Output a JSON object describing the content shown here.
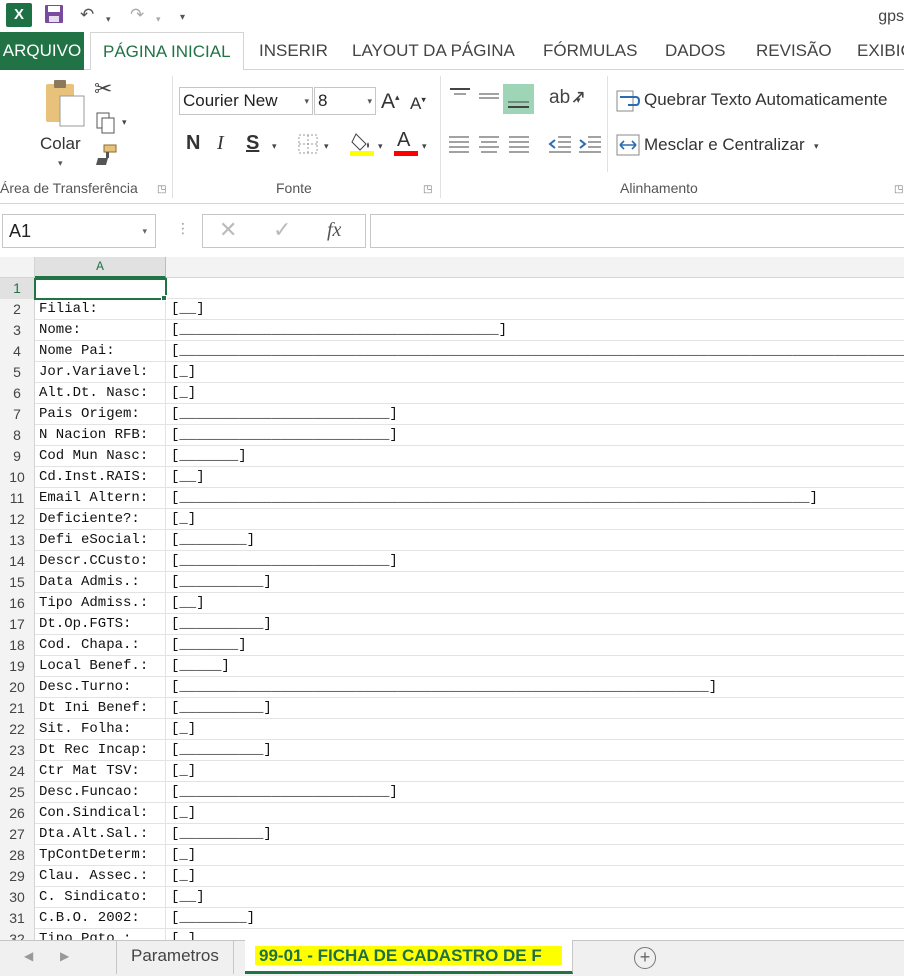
{
  "app": {
    "title": "gps"
  },
  "qat": {
    "logo_letter": "X",
    "save_icon": "save-icon",
    "undo_icon": "undo-icon",
    "redo_icon": "redo-icon",
    "customize_icon": "customize-qat-icon"
  },
  "tabs": [
    {
      "label": "ARQUIVO"
    },
    {
      "label": "PÁGINA INICIAL"
    },
    {
      "label": "INSERIR"
    },
    {
      "label": "LAYOUT DA PÁGINA"
    },
    {
      "label": "FÓRMULAS"
    },
    {
      "label": "DADOS"
    },
    {
      "label": "REVISÃO"
    },
    {
      "label": "EXIBIÇ"
    }
  ],
  "ribbon": {
    "clipboard": {
      "paste_label": "Colar",
      "group_label": "Área de Transferência"
    },
    "font": {
      "font_name": "Courier New",
      "font_size": "8",
      "grow": "A",
      "shrink": "A",
      "bold": "N",
      "italic": "I",
      "underline": "S",
      "font_color_letter": "A",
      "group_label": "Fonte"
    },
    "alignment": {
      "wrap_label": "Quebrar Texto Automaticamente",
      "merge_label": "Mesclar e Centralizar",
      "group_label": "Alinhamento"
    },
    "colors": {
      "accent": "#217346",
      "highlight": "#ffff00",
      "font_color": "#ff0000"
    }
  },
  "formula_bar": {
    "name_box": "A1",
    "fx": "fx",
    "formula": ""
  },
  "grid": {
    "column_header": "A",
    "rows": [
      {
        "n": "1",
        "label": "",
        "field": ""
      },
      {
        "n": "2",
        "label": "Filial:",
        "field": "[__]"
      },
      {
        "n": "3",
        "label": "Nome:",
        "field": "[______________________________________]"
      },
      {
        "n": "4",
        "label": "Nome Pai:",
        "field": "[__________________________________________________________________________________________]"
      },
      {
        "n": "5",
        "label": "Jor.Variavel:",
        "field": "[_]"
      },
      {
        "n": "6",
        "label": "Alt.Dt. Nasc:",
        "field": "[_]"
      },
      {
        "n": "7",
        "label": "Pais Origem:",
        "field": "[_________________________]"
      },
      {
        "n": "8",
        "label": "N Nacion RFB:",
        "field": "[_________________________]"
      },
      {
        "n": "9",
        "label": "Cod Mun Nasc:",
        "field": "[_______]"
      },
      {
        "n": "10",
        "label": "Cd.Inst.RAIS:",
        "field": "[__]"
      },
      {
        "n": "11",
        "label": "Email Altern:",
        "field": "[___________________________________________________________________________]"
      },
      {
        "n": "12",
        "label": "Deficiente?:",
        "field": "[_]"
      },
      {
        "n": "13",
        "label": "Defi eSocial:",
        "field": "[________]"
      },
      {
        "n": "14",
        "label": "Descr.CCusto:",
        "field": "[_________________________]"
      },
      {
        "n": "15",
        "label": "Data Admis.:",
        "field": "[__________]"
      },
      {
        "n": "16",
        "label": "Tipo Admiss.:",
        "field": "[__]"
      },
      {
        "n": "17",
        "label": "Dt.Op.FGTS:",
        "field": "[__________]"
      },
      {
        "n": "18",
        "label": "Cod. Chapa.:",
        "field": "[_______]"
      },
      {
        "n": "19",
        "label": "Local Benef.:",
        "field": "[_____]"
      },
      {
        "n": "20",
        "label": "Desc.Turno:",
        "field": "[_______________________________________________________________]"
      },
      {
        "n": "21",
        "label": "Dt Ini Benef:",
        "field": "[__________]"
      },
      {
        "n": "22",
        "label": "Sit. Folha:",
        "field": "[_]"
      },
      {
        "n": "23",
        "label": "Dt Rec Incap:",
        "field": "[__________]"
      },
      {
        "n": "24",
        "label": "Ctr Mat TSV:",
        "field": "[_]"
      },
      {
        "n": "25",
        "label": "Desc.Funcao:",
        "field": "[_________________________]"
      },
      {
        "n": "26",
        "label": "Con.Sindical:",
        "field": "[_]"
      },
      {
        "n": "27",
        "label": "Dta.Alt.Sal.:",
        "field": "[__________]"
      },
      {
        "n": "28",
        "label": "TpContDeterm:",
        "field": "[_]"
      },
      {
        "n": "29",
        "label": "Clau. Assec.:",
        "field": "[_]"
      },
      {
        "n": "30",
        "label": "C. Sindicato:",
        "field": "[__]"
      },
      {
        "n": "31",
        "label": "C.B.O. 2002:",
        "field": "[________]"
      },
      {
        "n": "32",
        "label": "Tipo Pgto.:",
        "field": "[_]"
      }
    ]
  },
  "sheets": [
    {
      "label": "Parametros"
    },
    {
      "label": "99-01 - FICHA DE CADASTRO DE F"
    }
  ]
}
